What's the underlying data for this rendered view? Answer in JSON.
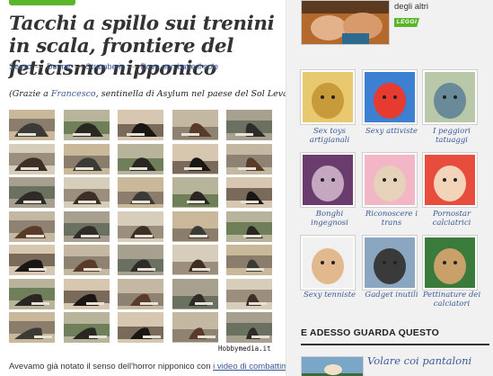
{
  "article": {
    "title": "Tacchi a spillo sui trenini in scala, frontiere del feticismo nipponico",
    "tags": [
      "Sesso",
      "Donne",
      "Stramberie",
      "Dove non batte il sole"
    ],
    "credit_prefix": "(Grazie a ",
    "credit_link": "Francesco",
    "credit_suffix": ", sentinella di Asylum nel paese del Sol Levante)",
    "watermark": "Hobbymedia.it",
    "body_prefix": "Avevamo già notato il senso dell'horror nipponico con ",
    "body_link": "i video di combattimenti"
  },
  "sidebar": {
    "top_text": "degli altri",
    "leggi": "LEGGI",
    "items": [
      {
        "caption": "Sex toys artigianali",
        "icon": "sex-toys-thumb"
      },
      {
        "caption": "Sexy attiviste",
        "icon": "activists-thumb"
      },
      {
        "caption": "I peggiori tatuaggi",
        "icon": "tattoo-thumb"
      },
      {
        "caption": "Bonghi ingegnosi",
        "icon": "bong-thumb"
      },
      {
        "caption": "Riconoscere i trans",
        "icon": "trans-thumb"
      },
      {
        "caption": "Pornostar calciatrici",
        "icon": "pornstar-thumb"
      },
      {
        "caption": "Sexy tenniste",
        "icon": "tennis-thumb"
      },
      {
        "caption": "Gadget inutili",
        "icon": "gadget-thumb"
      },
      {
        "caption": "Pettinature dei calciatori",
        "icon": "hairstyle-thumb"
      }
    ],
    "section_title": "E ADESSO GUARDA QUESTO",
    "next_title": "Volare coi pantaloni"
  },
  "colors": {
    "accent_green": "#5ab52a",
    "link_blue": "#3b5998"
  }
}
